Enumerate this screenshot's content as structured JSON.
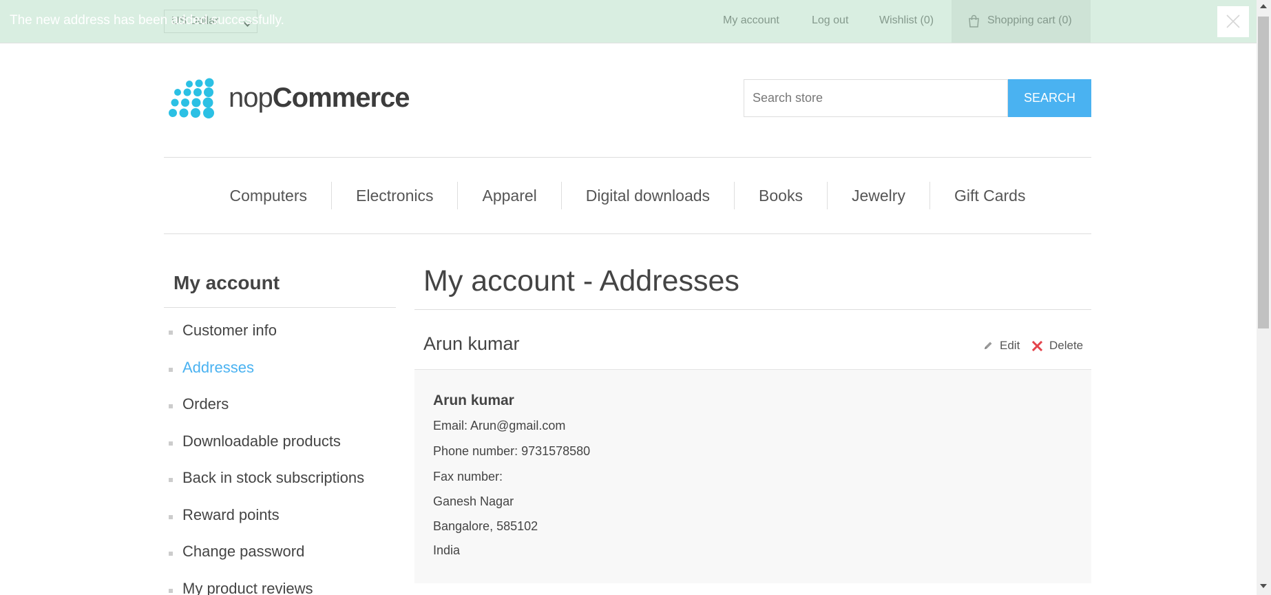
{
  "notification": {
    "text": "The new address has been added successfully."
  },
  "header": {
    "currency": "US Dollar",
    "my_account": "My account",
    "log_out": "Log out",
    "wishlist": "Wishlist (0)",
    "cart": "Shopping cart (0)"
  },
  "logo": {
    "prefix": "nop",
    "suffix": "Commerce"
  },
  "search": {
    "placeholder": "Search store",
    "button": "SEARCH"
  },
  "menu": [
    "Computers",
    "Electronics",
    "Apparel",
    "Digital downloads",
    "Books",
    "Jewelry",
    "Gift Cards"
  ],
  "sidebar": {
    "title": "My account",
    "items": [
      {
        "label": "Customer info"
      },
      {
        "label": "Addresses",
        "active": true
      },
      {
        "label": "Orders"
      },
      {
        "label": "Downloadable products"
      },
      {
        "label": "Back in stock subscriptions"
      },
      {
        "label": "Reward points"
      },
      {
        "label": "Change password"
      },
      {
        "label": "My product reviews"
      }
    ]
  },
  "main": {
    "title": "My account - Addresses",
    "address": {
      "title": "Arun kumar",
      "edit": "Edit",
      "delete": "Delete",
      "name": "Arun kumar",
      "email": "Email: Arun@gmail.com",
      "phone": "Phone number: 9731578580",
      "fax": "Fax number:",
      "street": "Ganesh Nagar",
      "city": "Bangalore, 585102",
      "country": "India"
    }
  },
  "colors": {
    "accent": "#4ab2f1",
    "notification_bg": "#9ad2b0",
    "delete_red": "#e4434b"
  }
}
